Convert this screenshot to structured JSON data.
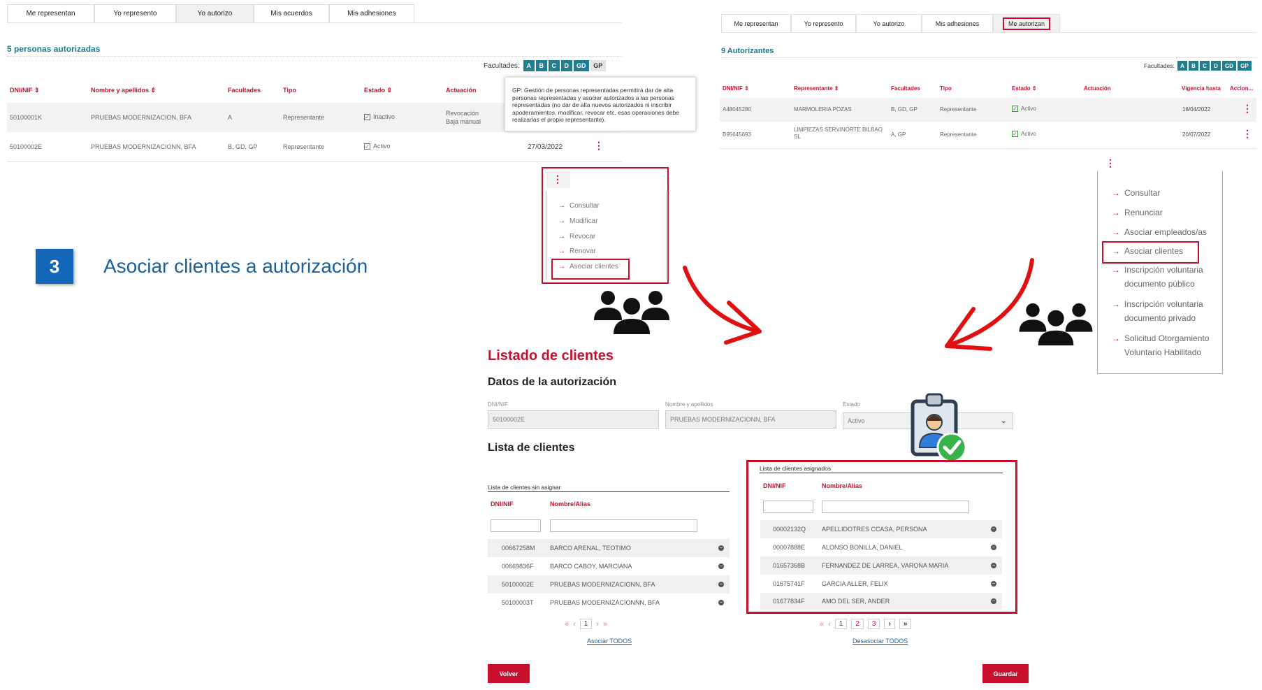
{
  "left_panel": {
    "tabs": [
      "Me representan",
      "Yo represento",
      "Yo autorizo",
      "Mis acuerdos",
      "Mis adhesiones"
    ],
    "title": "5 personas autorizadas",
    "facultades_label": "Facultades:",
    "facultades": [
      "A",
      "B",
      "C",
      "D",
      "GD",
      "GP"
    ],
    "columns": [
      "DNI/NIF ⇕",
      "Nombre y apellidos ⇕",
      "Facultades",
      "Tipo",
      "Estado ⇕",
      "Actuación"
    ],
    "rows": [
      {
        "dni": "50100001K",
        "nombre": "PRUEBAS MODERNIZACION, BFA",
        "fac": "A",
        "tipo": "Representante",
        "estado": "Inactivo",
        "act1": "Revocación",
        "act2": "Baja manual",
        "fecha": ""
      },
      {
        "dni": "50100002E",
        "nombre": "PRUEBAS MODERNIZACIONN, BFA",
        "fac": "B, GD, GP",
        "tipo": "Representante",
        "estado": "Activo",
        "act1": "",
        "act2": "",
        "fecha": "27/03/2022"
      }
    ],
    "tooltip": "GP: Gestión de personas representadas permitirá dar de alta personas representadas y asociar autorizados a las personas representadas (no dar de alta nuevos autorizados ni inscribir apoderamientos, modificar, revocar etc. esas operaciones debe realizarlas el propio representante).",
    "menu": [
      "Consultar",
      "Modificar",
      "Revocar",
      "Renovar",
      "Asociar clientes"
    ]
  },
  "right_panel": {
    "tabs": [
      "Me representan",
      "Yo represento",
      "Yo autorizo",
      "Mis adhesiones",
      "Me autorizan"
    ],
    "title": "9 Autorizantes",
    "facultades_label": "Facultades:",
    "facultades": [
      "A",
      "B",
      "C",
      "D",
      "GD",
      "GP"
    ],
    "columns": [
      "DNI/NIF ⇕",
      "Representante ⇕",
      "Facultades",
      "Tipo",
      "Estado ⇕",
      "Actuación",
      "Vigencia hasta",
      "Accion..."
    ],
    "rows": [
      {
        "dni": "A48045280",
        "nombre": "MARMOLERIA POZAS",
        "fac": "B, GD, GP",
        "tipo": "Representante",
        "estado": "Activo",
        "fecha": "16/04/2022"
      },
      {
        "dni": "B95645693",
        "nombre": "LIMPIEZAS SERVINORTE BILBAO SL",
        "fac": "A, GP",
        "tipo": "Representante",
        "estado": "Activo",
        "fecha": "20/07/2022"
      }
    ],
    "menu": [
      "Consultar",
      "Renunciar",
      "Asociar empleados/as",
      "Asociar clientes",
      "Inscripción voluntaria documento público",
      "Inscripción voluntaria documento privado",
      "Solicitud Otorgamiento Voluntario Habilitado"
    ]
  },
  "step": {
    "number": "3",
    "title": "Asociar clientes a autorización"
  },
  "listado": {
    "title": "Listado de clientes",
    "subtitle": "Datos de la autorización",
    "dni_label": "DNI/NIF",
    "dni_value": "50100002E",
    "nombre_label": "Nombre y apellidos",
    "nombre_value": "PRUEBAS MODERNIZACIONN, BFA",
    "estado_label": "Estado",
    "estado_value": "Activo",
    "lista_title": "Lista de clientes",
    "sin_asignar": {
      "title": "Lista de clientes sin asignar",
      "col1": "DNI/NIF",
      "col2": "Nombre/Alias",
      "rows": [
        {
          "dni": "00667258M",
          "nombre": "BARCO ARENAL, TEOTIMO"
        },
        {
          "dni": "00669836F",
          "nombre": "BARCO CABOY, MARCIANA"
        },
        {
          "dni": "50100002E",
          "nombre": "PRUEBAS MODERNIZACIONN, BFA"
        },
        {
          "dni": "50100003T",
          "nombre": "PRUEBAS MODERNIZACIONNN, BFA"
        }
      ],
      "pages": [
        "1"
      ],
      "link": "Asociar TODOS"
    },
    "asignados": {
      "title": "Lista de clientes asignados",
      "col1": "DNI/NIF",
      "col2": "Nombre/Alias",
      "rows": [
        {
          "dni": "00002132Q",
          "nombre": "APELLIDOTRES CCASA, PERSONA"
        },
        {
          "dni": "00007888E",
          "nombre": "ALONSO BONILLA, DANIEL"
        },
        {
          "dni": "01657368B",
          "nombre": "FERNANDEZ DE LARREA, VARONA MARIA"
        },
        {
          "dni": "01675741F",
          "nombre": "GARCIA ALLER, FELIX"
        },
        {
          "dni": "01677834F",
          "nombre": "AMO DEL SER, ANDER"
        }
      ],
      "pages": [
        "1",
        "2",
        "3"
      ],
      "link": "Desasociar TODOS"
    },
    "volver": "Volver",
    "guardar": "Guardar"
  },
  "colors": {
    "accent": "#c8102e",
    "teal": "#1f7f90",
    "title_blue": "#1a5f9a"
  }
}
